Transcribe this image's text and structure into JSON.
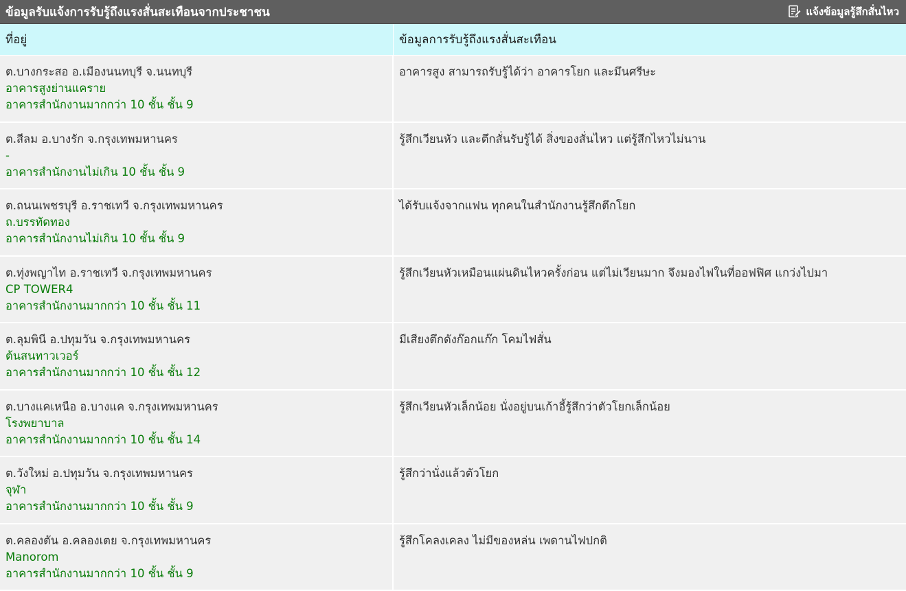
{
  "header": {
    "title": "ข้อมูลรับแจ้งการรับรู้ถึงแรงสั่นสะเทือนจากประชาชน",
    "report_button": "แจ้งข้อมูลรู้สึกสั่นไหว",
    "report_icon": "edit-document-icon"
  },
  "table": {
    "columns": [
      "ที่อยู่",
      "ข้อมูลการรับรู้ถึงแรงสั่นสะเทือน"
    ],
    "rows": [
      {
        "address": "ต.บางกระสอ อ.เมืองนนทบุรี จ.นนทบุรี",
        "building": "อาคารสูงย่านแคราย",
        "building_type": "อาคารสำนักงานมากกว่า 10 ชั้น ชั้น 9",
        "description": "อาคารสูง สามารถรับรู้ได้ว่า อาคารโยก และมึนศรีษะ"
      },
      {
        "address": "ต.สีลม อ.บางรัก จ.กรุงเทพมหานคร",
        "building": "-",
        "building_type": "อาคารสำนักงานไม่เกิน 10 ชั้น ชั้น 9",
        "description": "รู้สึกเวียนหัว และตึกสั่นรับรู้ได้ สิ่งของสั่นไหว แต่รู้สึกไหวไม่นาน"
      },
      {
        "address": "ต.ถนนเพชรบุรี อ.ราชเทวี จ.กรุงเทพมหานคร",
        "building": "ถ.บรรทัดทอง",
        "building_type": "อาคารสำนักงานไม่เกิน 10 ชั้น ชั้น 9",
        "description": "ได้รับแจ้งจากแฟน ทุกคนในสำนักงานรู้สึกตึกโยก"
      },
      {
        "address": "ต.ทุ่งพญาไท อ.ราชเทวี จ.กรุงเทพมหานคร",
        "building": "CP TOWER4",
        "building_type": "อาคารสำนักงานมากกว่า 10 ชั้น ชั้น 11",
        "description": "รู้สึกเวียนหัวเหมือนแผ่นดินไหวครั้งก่อน แต่ไม่เวียนมาก จึงมองไฟในที่ออฟฟิศ แกว่งไปมา"
      },
      {
        "address": "ต.ลุมพินี อ.ปทุมวัน จ.กรุงเทพมหานคร",
        "building": "ต้นสนทาวเวอร์",
        "building_type": "อาคารสำนักงานมากกว่า 10 ชั้น ชั้น 12",
        "description": "มีเสียงตึกดังก๊อกแก๊ก โคมไฟสั่น"
      },
      {
        "address": "ต.บางแคเหนือ อ.บางแค จ.กรุงเทพมหานคร",
        "building": "โรงพยาบาล",
        "building_type": "อาคารสำนักงานมากกว่า 10 ชั้น ชั้น 14",
        "description": "รู้สึกเวียนหัวเล็กน้อย นั่งอยู่บนเก้าอี้รู้สึกว่าตัวโยกเล็กน้อย"
      },
      {
        "address": "ต.วังใหม่ อ.ปทุมวัน จ.กรุงเทพมหานคร",
        "building": "จุฬา",
        "building_type": "อาคารสำนักงานมากกว่า 10 ชั้น ชั้น 9",
        "description": "รู้สึกว่านั่งแล้วตัวโยก"
      },
      {
        "address": "ต.คลองตัน อ.คลองเตย จ.กรุงเทพมหานคร",
        "building": "Manorom",
        "building_type": "อาคารสำนักงานมากกว่า 10 ชั้น ชั้น 9",
        "description": "รู้สึกโคลงเคลง ไม่มีของหล่น เพดานไฟปกติ"
      }
    ]
  },
  "colors": {
    "titlebar_bg": "#5f5f5f",
    "header_bg": "#cdf8fb",
    "row_bg": "#f0f0f0",
    "building_text": "#0a7d0a"
  }
}
